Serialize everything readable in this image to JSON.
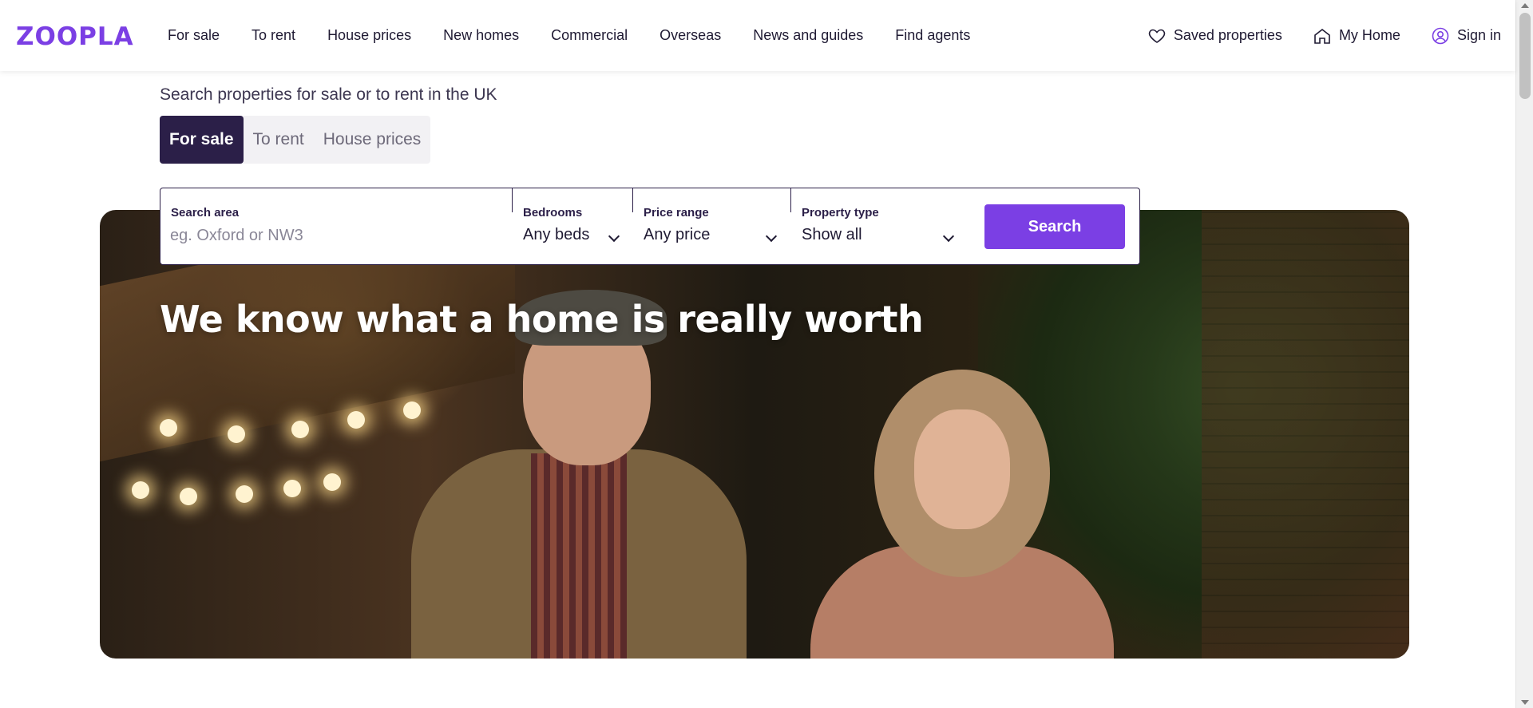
{
  "brand": {
    "logo_text": "ZOOPLA",
    "accent_color": "#7b3fe4",
    "dark_color": "#2b1f48"
  },
  "nav": {
    "items": [
      {
        "label": "For sale"
      },
      {
        "label": "To rent"
      },
      {
        "label": "House prices"
      },
      {
        "label": "New homes"
      },
      {
        "label": "Commercial"
      },
      {
        "label": "Overseas"
      },
      {
        "label": "News and guides"
      },
      {
        "label": "Find agents"
      }
    ],
    "right": {
      "saved": {
        "label": "Saved properties",
        "icon": "heart-icon"
      },
      "my_home": {
        "label": "My Home",
        "icon": "house-icon"
      },
      "sign_in": {
        "label": "Sign in",
        "icon": "user-circle-icon"
      }
    }
  },
  "intro": "Search properties for sale or to rent in the UK",
  "tabs": [
    {
      "label": "For sale",
      "active": true
    },
    {
      "label": "To rent",
      "active": false
    },
    {
      "label": "House prices",
      "active": false
    }
  ],
  "search": {
    "area": {
      "label": "Search area",
      "placeholder": "eg. Oxford or NW3",
      "value": ""
    },
    "bedrooms": {
      "label": "Bedrooms",
      "value": "Any beds"
    },
    "price": {
      "label": "Price range",
      "value": "Any price"
    },
    "type": {
      "label": "Property type",
      "value": "Show all"
    },
    "button": "Search"
  },
  "hero": {
    "title": "We know what a home is really worth"
  }
}
